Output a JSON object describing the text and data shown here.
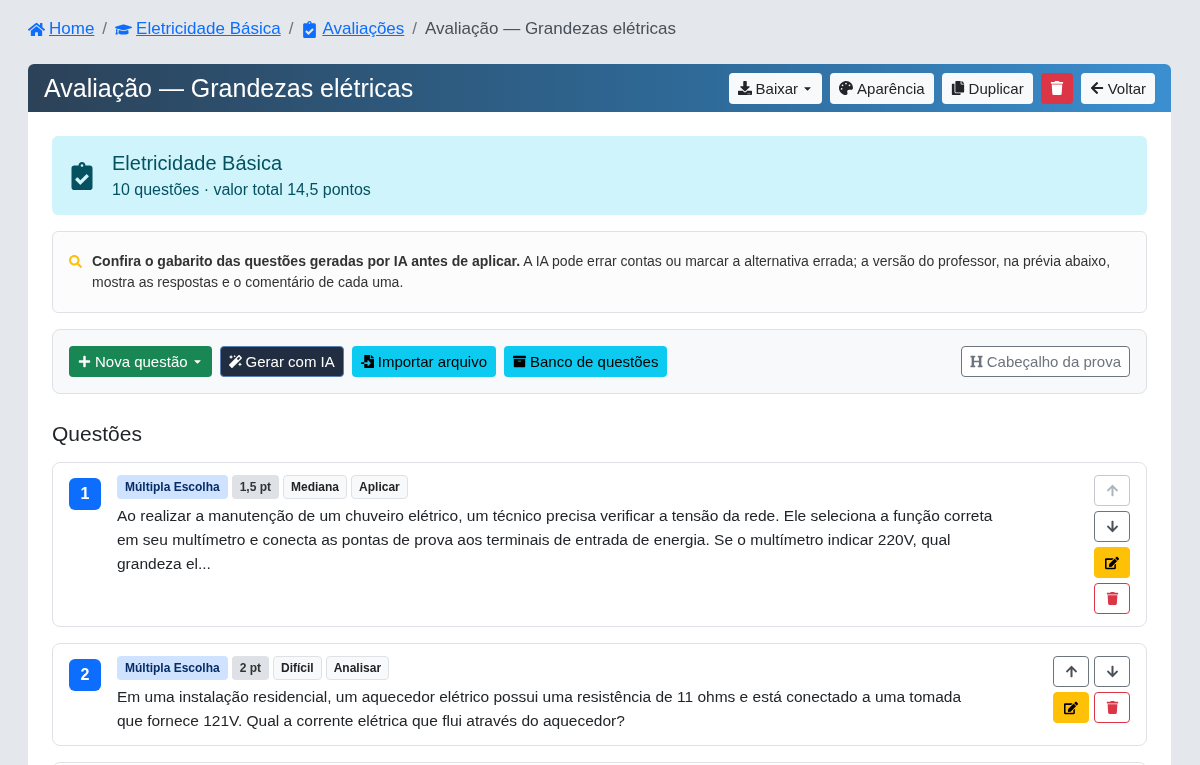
{
  "breadcrumb": [
    {
      "label": "Home",
      "link": true
    },
    {
      "separator": "/",
      "label": "Eletricidade Básica",
      "link": true
    },
    {
      "separator": "/",
      "label": "Avaliações",
      "link": true
    },
    {
      "separator": "/",
      "label": "Avaliação — Grandezas elétricas",
      "link": false
    }
  ],
  "header": {
    "title": "Avaliação — Grandezas elétricas",
    "buttons": [
      {
        "kind": "dropdown",
        "label": "Baixar"
      },
      {
        "kind": "light",
        "label": "Aparência"
      },
      {
        "kind": "light",
        "label": "Duplicar"
      },
      {
        "kind": "danger"
      },
      {
        "kind": "light",
        "label": "Voltar"
      }
    ]
  },
  "summary": {
    "title": "Eletricidade Básica",
    "subtitle": "10 questões · valor total 14,5 pontos"
  },
  "notice": "**Confira o gabarito das questões geradas por IA antes de aplicar.** A IA pode errar contas ou marcar a alternativa errada; a versão do professor, na prévia abaixo, mostra as respostas e o comentário de cada uma.",
  "toolbar": [
    {
      "kind": "success",
      "label": "Nova questão"
    },
    {
      "kind": "dark",
      "label": "Gerar com IA"
    },
    {
      "kind": "info",
      "label": "Importar arquivo"
    },
    {
      "kind": "info",
      "label": "Banco de questões"
    },
    {
      "kind": "outline",
      "label": "Cabeçalho da prova"
    }
  ],
  "section_title": "Questões",
  "questions": [
    {
      "kind": "question",
      "number": "1",
      "type": "Múltipla Escolha",
      "points": "1,5 pt",
      "difficulty": "Mediana",
      "skill": "Aplicar",
      "text": "Ao realizar a manutenção de um chuveiro elétrico, um técnico precisa verificar a tensão da rede. Ele seleciona a função correta em seu multímetro e conecta as pontas de prova aos terminais de entrada de energia. Se o multímetro indicar 220V, qual grandeza el...",
      "two_columns": false,
      "up_disabled": true
    },
    {
      "kind": "question",
      "number": "2",
      "type": "Múltipla Escolha",
      "points": "2 pt",
      "difficulty": "Difícil",
      "skill": "Analisar",
      "text": "Em uma instalação residencial, um aquecedor elétrico possui uma resistência de 11 ohms e está conectado a uma tomada que fornece 121V. Qual a corrente elétrica que flui através do aquecedor?",
      "two_columns": true,
      "up_disabled": false
    },
    {
      "kind": "partial"
    }
  ]
}
